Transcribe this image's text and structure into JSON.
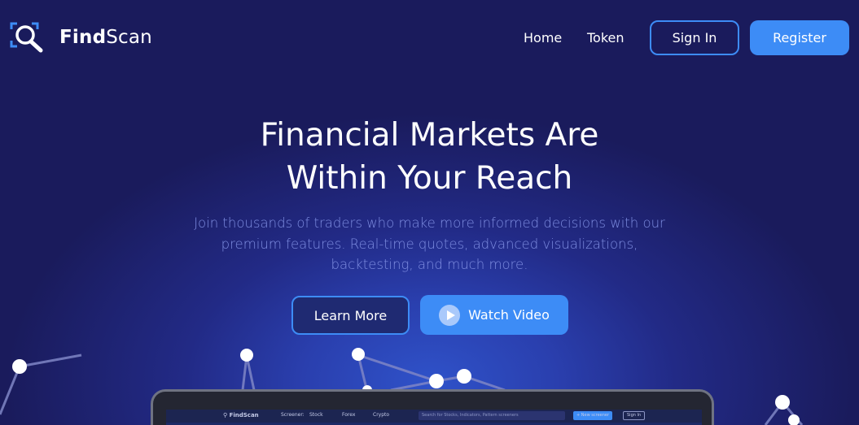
{
  "brand": {
    "name_bold": "Find",
    "name_regular": "Scan"
  },
  "nav": {
    "home": "Home",
    "token": "Token",
    "sign_in": "Sign In",
    "register": "Register"
  },
  "hero": {
    "title_line1": "Financial Markets Are",
    "title_line2": "Within Your Reach",
    "subtitle_line1": "Join thousands of traders who make more informed decisions with our",
    "subtitle_line2": "premium features. Real-time quotes, advanced visualizations,",
    "subtitle_line3": "backtesting, and much more.",
    "learn_more": "Learn More",
    "watch_video": "Watch Video"
  },
  "preview": {
    "brand": "FindScan",
    "screener_label": "Screener:",
    "tabs": [
      "Stock",
      "Forex",
      "Crypto"
    ],
    "search_placeholder": "Search for Stocks, Indicators, Pattern screeners",
    "new_screener": "+ New screener",
    "sign_in": "Sign In"
  },
  "colors": {
    "accent": "#3d8cf6",
    "background": "#1a1b5c",
    "subtitle": "#7d8ce0"
  }
}
